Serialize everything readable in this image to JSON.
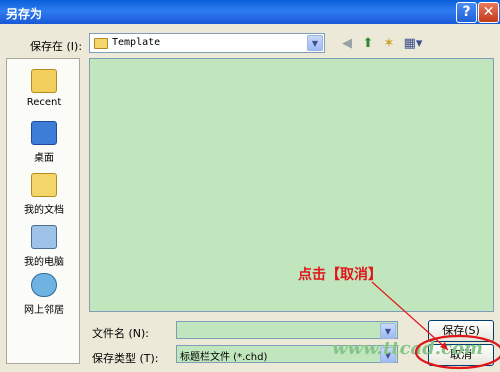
{
  "window": {
    "title": "另存为",
    "help_glyph": "?",
    "close_glyph": "✕"
  },
  "save_in": {
    "label": "保存在 (I):",
    "value": "Template"
  },
  "toolbar": {
    "icons": [
      "back-icon",
      "up-folder-icon",
      "new-folder-icon",
      "views-menu-icon"
    ]
  },
  "places": [
    {
      "label": "Recent",
      "icon": "recent-icon"
    },
    {
      "label": "桌面",
      "icon": "desktop-icon"
    },
    {
      "label": "我的文档",
      "icon": "my-documents-icon"
    },
    {
      "label": "我的电脑",
      "icon": "my-computer-icon"
    },
    {
      "label": "网上邻居",
      "icon": "network-places-icon"
    }
  ],
  "file_name": {
    "label": "文件名 (N):",
    "value": ""
  },
  "file_type": {
    "label": "保存类型 (T):",
    "value": "标题栏文件 (*.chd)"
  },
  "buttons": {
    "save": "保存(S)",
    "cancel": "取消"
  },
  "annotation": {
    "text": "点击【取消】",
    "color": "#e0161b"
  },
  "watermark": {
    "text": "www.ttcad.com"
  },
  "colors": {
    "accent": "#1858d6",
    "pane_bg": "#c1e6bd",
    "dialog_bg": "#ece9d8"
  }
}
